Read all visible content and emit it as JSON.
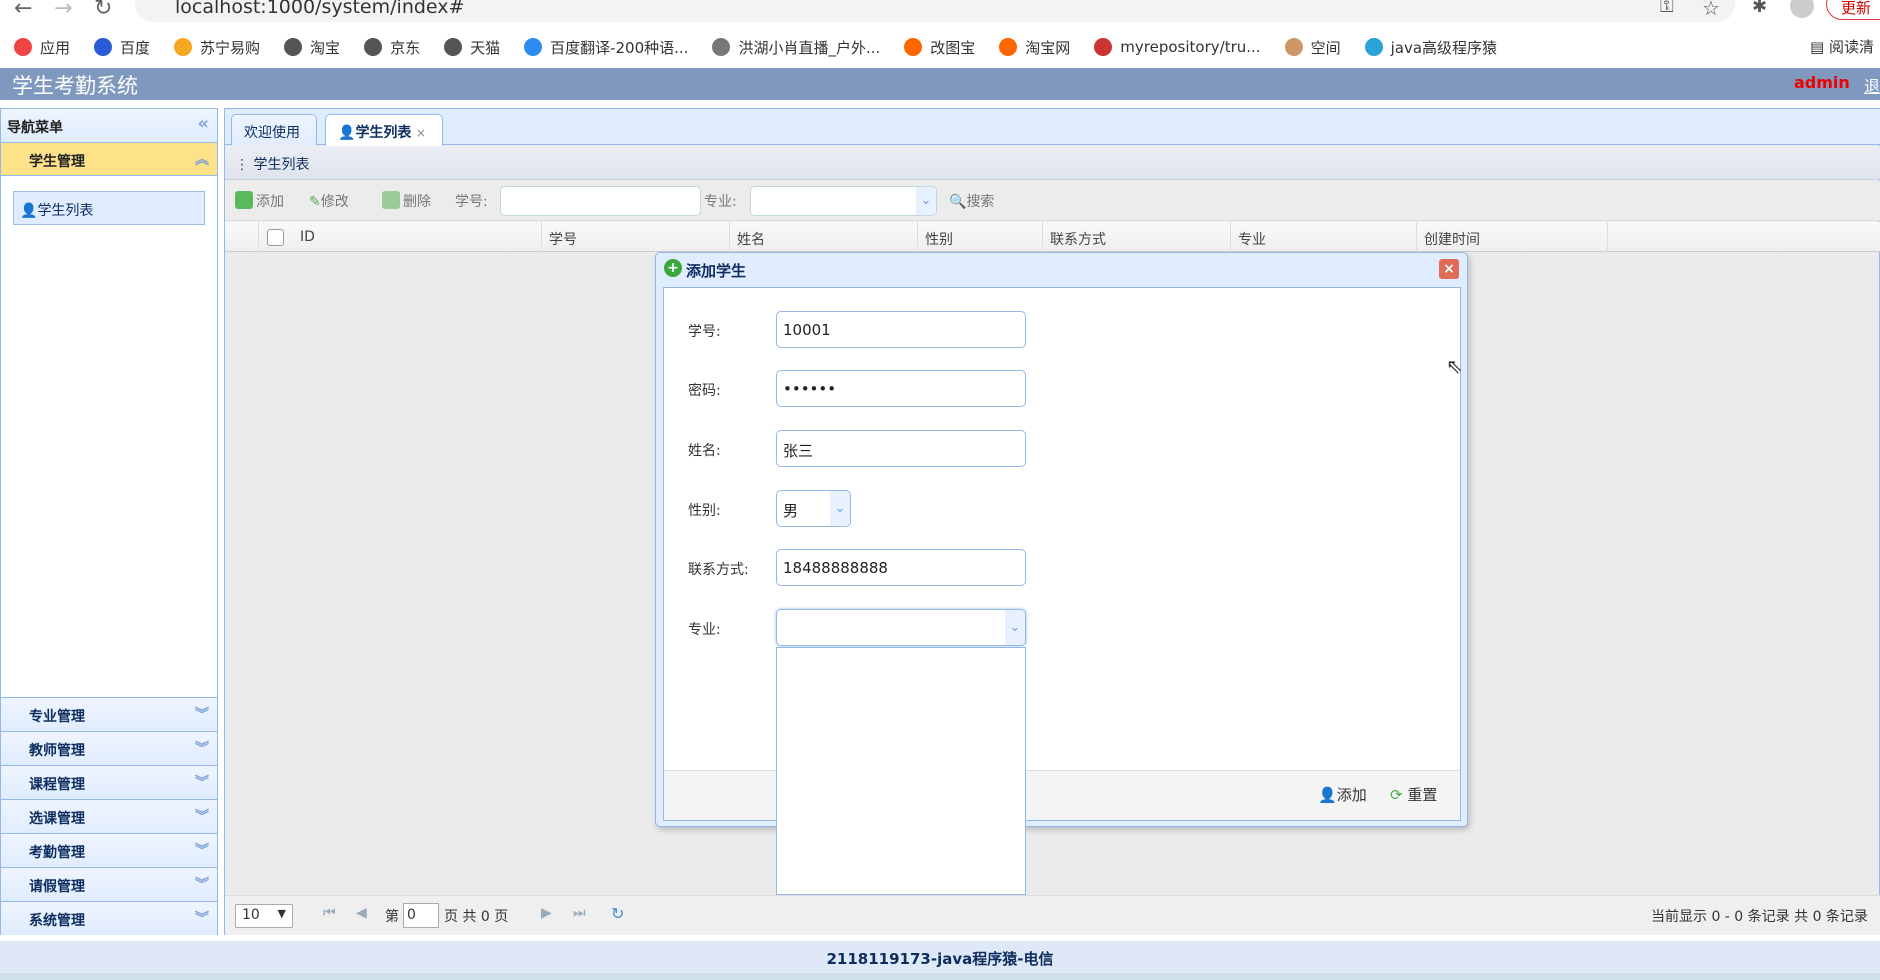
{
  "browser": {
    "url": "localhost:1000/system/index#",
    "update_label": "更新",
    "reading_list": "阅读清",
    "bookmarks": [
      "应用",
      "百度",
      "苏宁易购",
      "淘宝",
      "京东",
      "天猫",
      "百度翻译-200种语...",
      "洪湖小肖直播_户外...",
      "改图宝",
      "淘宝网",
      "myrepository/tru...",
      "空间",
      "java高级程序猿"
    ]
  },
  "header": {
    "title": "学生考勤系统",
    "user": "admin",
    "logout": "退"
  },
  "sidebar": {
    "title": "导航菜单",
    "active_group": "学生管理",
    "active_item": "学生列表",
    "groups": [
      "专业管理",
      "教师管理",
      "课程管理",
      "选课管理",
      "考勤管理",
      "请假管理",
      "系统管理"
    ]
  },
  "tabs": [
    "欢迎使用",
    "学生列表"
  ],
  "panel": {
    "title": "学生列表"
  },
  "toolbar": {
    "add": "添加",
    "edit": "修改",
    "delete": "删除",
    "sn_label": "学号:",
    "major_label": "专业:",
    "search": "搜索"
  },
  "grid": {
    "columns": [
      "ID",
      "学号",
      "姓名",
      "性别",
      "联系方式",
      "专业",
      "创建时间"
    ]
  },
  "pagination": {
    "page_size": "10",
    "page_prefix": "第",
    "page": "0",
    "page_suffix": "页 共 0 页",
    "summary": "当前显示 0 - 0 条记录 共 0 条记录"
  },
  "dialog": {
    "title": "添加学生",
    "fields": [
      {
        "label": "学号:",
        "value": "10001"
      },
      {
        "label": "密码:",
        "value": "••••••"
      },
      {
        "label": "姓名:",
        "value": "张三"
      },
      {
        "label": "性别:",
        "value": "男"
      },
      {
        "label": "联系方式:",
        "value": "18488888888"
      },
      {
        "label": "专业:",
        "value": ""
      }
    ],
    "add": "添加",
    "reset": "重置"
  },
  "footer": "2118119173-java程序猿-电信",
  "colors": {
    "header": "#7f99be",
    "active_group": "#fde28a",
    "border": "#95b8e7",
    "admin": "#ee0000"
  }
}
